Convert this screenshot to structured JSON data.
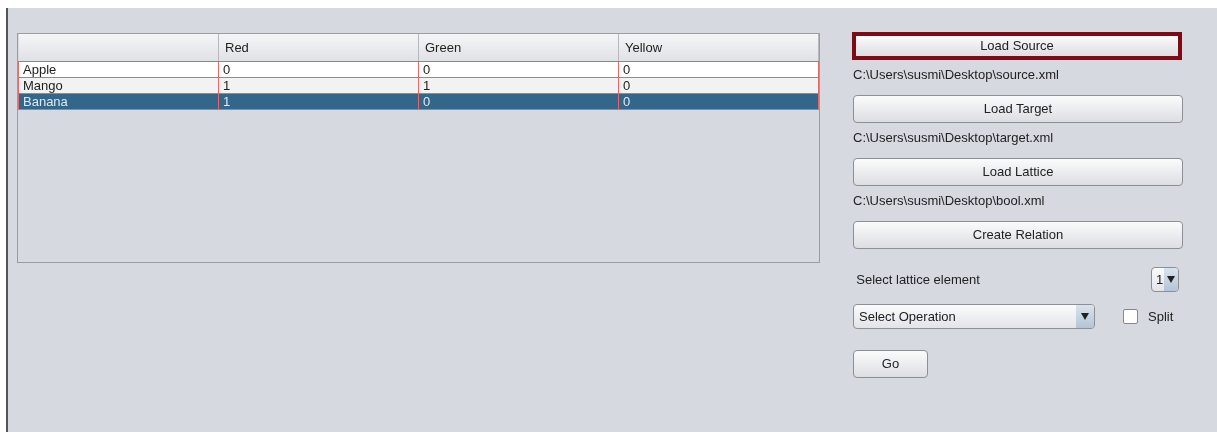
{
  "table": {
    "columns": [
      "Red",
      "Green",
      "Yellow"
    ],
    "rows": [
      {
        "name": "Apple",
        "values": [
          "0",
          "0",
          "0"
        ],
        "selected": false
      },
      {
        "name": "Mango",
        "values": [
          "1",
          "1",
          "0"
        ],
        "selected": false
      },
      {
        "name": "Banana",
        "values": [
          "1",
          "0",
          "0"
        ],
        "selected": true
      }
    ]
  },
  "actions": [
    {
      "kind": "button",
      "label": "Load Source",
      "focused": true
    },
    {
      "kind": "path",
      "text": "C:\\Users\\susmi\\Desktop\\source.xml"
    },
    {
      "kind": "button",
      "label": "Load Target",
      "focused": false
    },
    {
      "kind": "path",
      "text": "C:\\Users\\susmi\\Desktop\\target.xml"
    },
    {
      "kind": "button",
      "label": "Load Lattice",
      "focused": false
    },
    {
      "kind": "path",
      "text": "C:\\Users\\susmi\\Desktop\\bool.xml"
    },
    {
      "kind": "button",
      "label": "Create Relation",
      "focused": false
    }
  ],
  "lattice_element": {
    "label": "Select lattice element",
    "value": "1"
  },
  "operation": {
    "value": "Select Operation"
  },
  "split": {
    "label": "Split",
    "checked": false
  },
  "go_button": {
    "label": "Go"
  }
}
